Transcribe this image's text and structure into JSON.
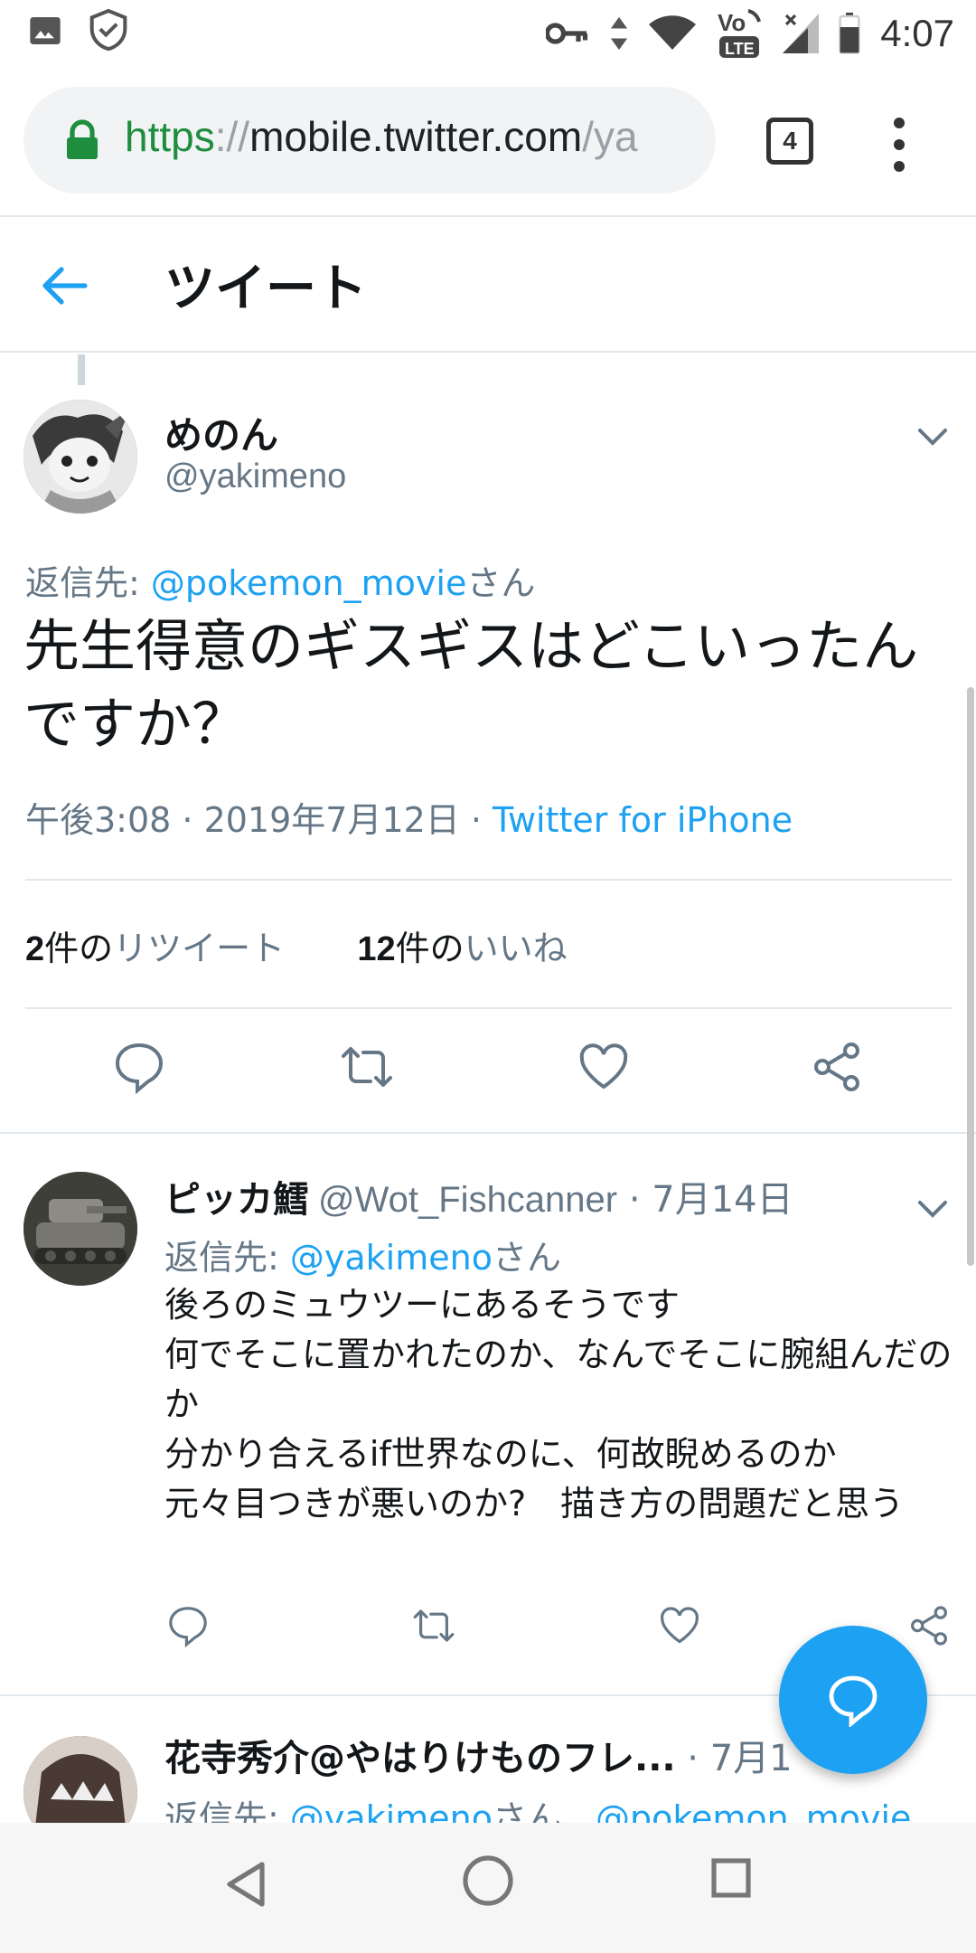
{
  "status_bar": {
    "time": "4:07",
    "network_label": "VoLTE",
    "icons": [
      "image-icon",
      "shield-check-icon",
      "vpn-key-icon",
      "data-arrows-icon",
      "wifi-icon",
      "volte-icon",
      "signal-icon",
      "battery-icon"
    ]
  },
  "browser": {
    "url_scheme": "https",
    "url_separator": "://",
    "url_host": "mobile.twitter.com",
    "url_path": "/ya",
    "tab_count": "4"
  },
  "header": {
    "title": "ツイート"
  },
  "tweet": {
    "name": "めのん",
    "handle": "@yakimeno",
    "reply_to_label": "返信先: ",
    "reply_to_handle": "@pokemon_movie",
    "reply_to_suffix": "さん",
    "text": "先生得意のギスギスはどこいったんですか？",
    "time": "午後3:08 · 2019年7月12日 · ",
    "source": "Twitter for iPhone",
    "retweet_count": "2",
    "retweet_label": "件の",
    "retweet_word": "リツイート",
    "like_count": "12",
    "like_label": "件の",
    "like_word": "いいね"
  },
  "replies": [
    {
      "name": "ピッカ鱈",
      "handle": "@Wot_Fishcanner",
      "date": " · 7月14日",
      "reply_to_label": "返信先: ",
      "reply_to_handle": "@yakimeno",
      "reply_to_suffix": "さん",
      "text": "後ろのミュウツーにあるそうです\n何でそこに置かれたのか、なんでそこに腕組んだのか\n分かり合えるif世界なのに、何故睨めるのか\n元々目つきが悪いのか?　描き方の問題だと思う"
    },
    {
      "name": "花寺秀介@やはりけものフレ...",
      "date": " · 7月1",
      "reply_to_label": "返信先: ",
      "reply_to_handle": "@yakimeno",
      "reply_to_suffix": "さん、",
      "reply_to_handle_2": "@pokemon_movie"
    }
  ],
  "colors": {
    "accent": "#1da1f2",
    "secondary_text": "#657786",
    "primary_text": "#14171a",
    "secure_green": "#1e8e3e"
  }
}
